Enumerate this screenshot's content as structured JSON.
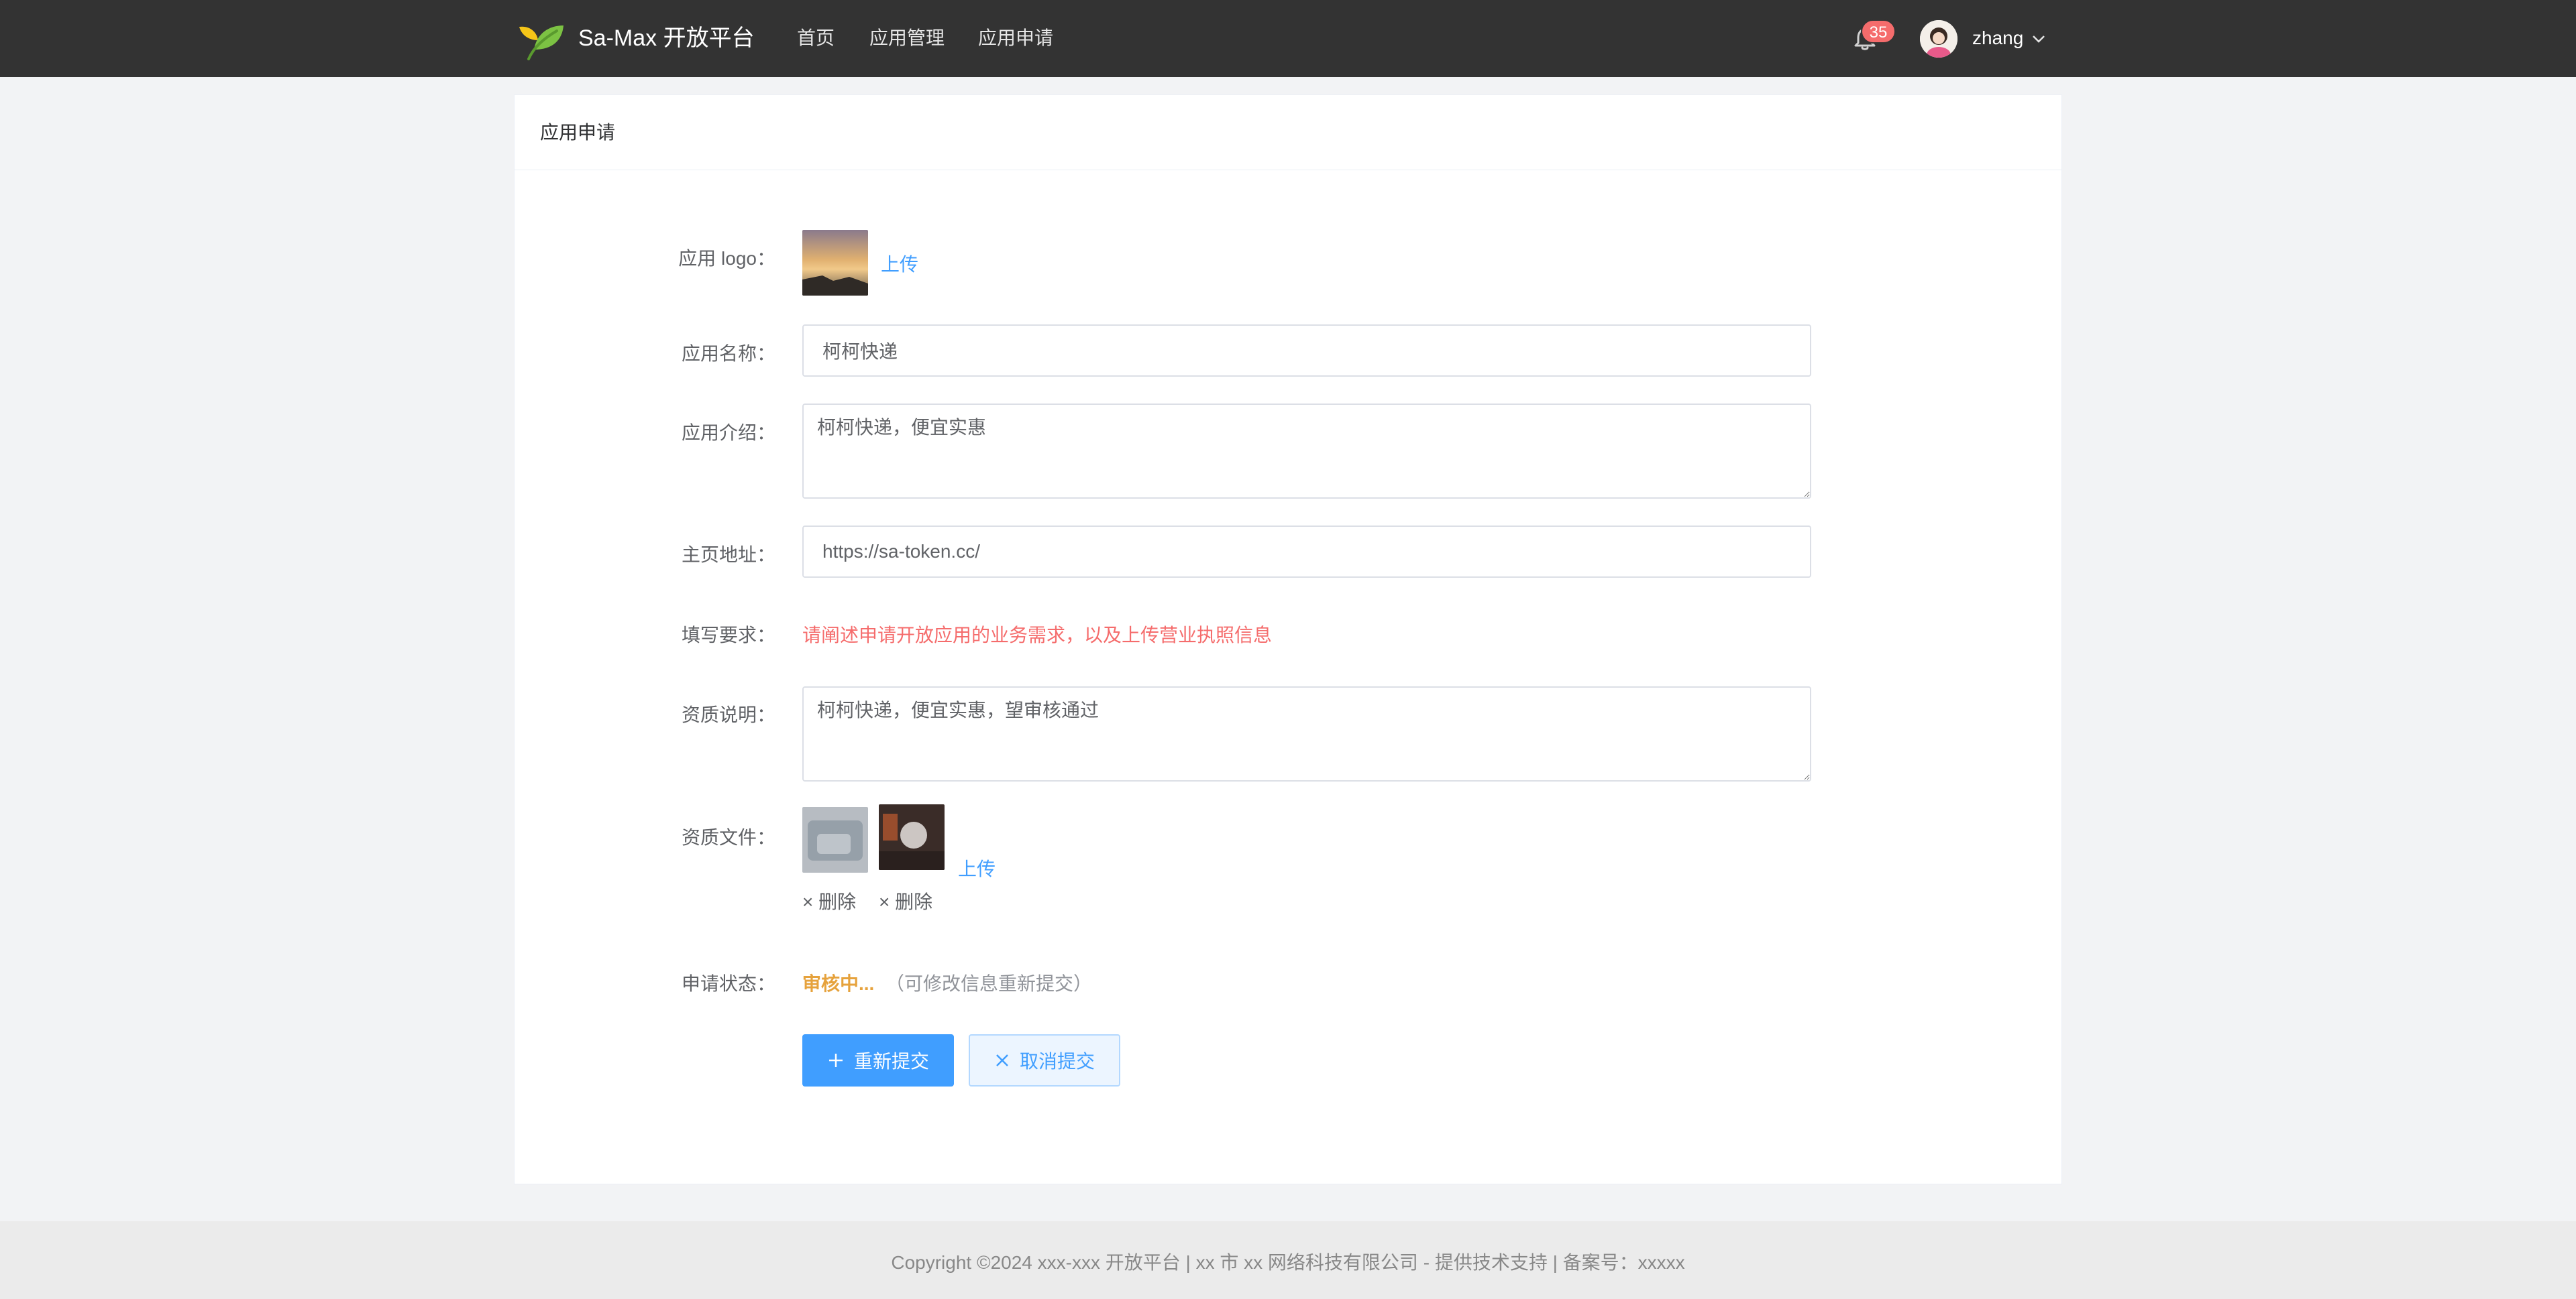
{
  "header": {
    "brand": "Sa-Max 开放平台",
    "nav": [
      "首页",
      "应用管理",
      "应用申请"
    ],
    "notification_count": "35",
    "username": "zhang"
  },
  "card": {
    "title": "应用申请"
  },
  "form": {
    "logo_label": "应用 logo：",
    "logo_upload": "上传",
    "name_label": "应用名称：",
    "name_value": "柯柯快递",
    "intro_label": "应用介绍：",
    "intro_value": "柯柯快递，便宜实惠",
    "homepage_label": "主页地址：",
    "homepage_value": "https://sa-token.cc/",
    "requirement_label": "填写要求：",
    "requirement_text": "请阐述申请开放应用的业务需求，以及上传营业执照信息",
    "qualification_label": "资质说明：",
    "qualification_value": "柯柯快递，便宜实惠，望审核通过",
    "files_label": "资质文件：",
    "files_upload": "上传",
    "delete_label": "× 删除",
    "status_label": "申请状态：",
    "status_value": "审核中...",
    "status_note": "（可修改信息重新提交）",
    "resubmit_button": "重新提交",
    "cancel_button": "取消提交"
  },
  "footer": {
    "copyright": "Copyright ©2024 xxx-xxx 开放平台 | xx 市 xx 网络科技有限公司 - 提供技术支持 | 备案号：xxxxx"
  },
  "colors": {
    "header_bg": "#333333",
    "primary": "#409eff",
    "danger": "#f56c6c",
    "warning": "#e6a23c"
  }
}
